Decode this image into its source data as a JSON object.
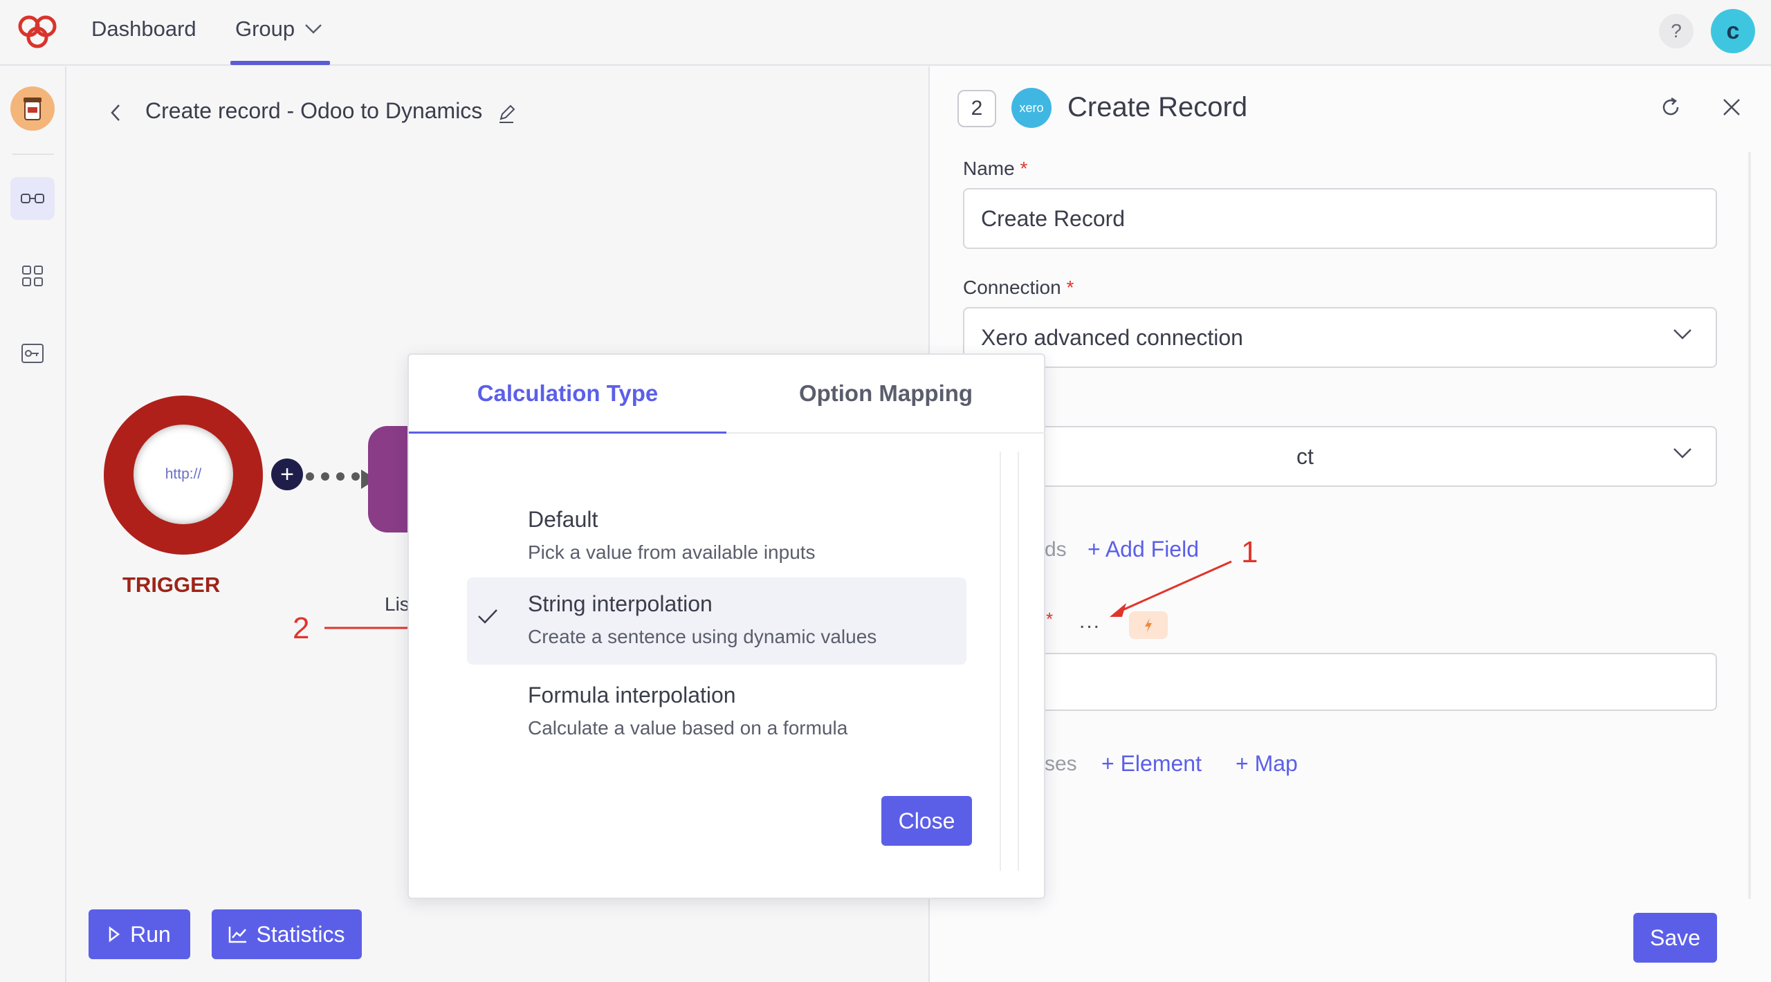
{
  "nav": {
    "dashboard": "Dashboard",
    "group": "Group",
    "help": "?",
    "avatar_initial": "c"
  },
  "canvas": {
    "title": "Create record - Odoo to Dynamics",
    "trigger_protocol": "http://",
    "trigger_label": "TRIGGER",
    "list_label": "Lis",
    "run_label": "Run",
    "statistics_label": "Statistics"
  },
  "panel": {
    "step_number": "2",
    "app_logo_text": "xero",
    "title": "Create Record",
    "name_label": "Name",
    "name_value": "Create Record",
    "connection_label": "Connection",
    "connection_value": "Xero advanced connection",
    "object_value_partial": "ct",
    "fields_label_partial": "ds",
    "add_field": "+ Add Field",
    "required_mark": "*",
    "more": "...",
    "uses_label_partial": "ses",
    "add_element": "+ Element",
    "add_map": "+ Map",
    "save_label": "Save"
  },
  "popover": {
    "tabs": [
      "Calculation Type",
      "Option Mapping"
    ],
    "options": [
      {
        "title": "Default",
        "description": "Pick a value from available inputs",
        "selected": false
      },
      {
        "title": "String interpolation",
        "description": "Create a sentence using dynamic values",
        "selected": true
      },
      {
        "title": "Formula interpolation",
        "description": "Calculate a value based on a formula",
        "selected": false
      }
    ],
    "close_label": "Close"
  },
  "annotations": {
    "marker_1": "1",
    "marker_2": "2"
  },
  "colors": {
    "accent": "#5b5fe8",
    "trigger_red": "#b0201b",
    "annotation_red": "#e0352b",
    "xero_blue": "#3fb7e2"
  }
}
